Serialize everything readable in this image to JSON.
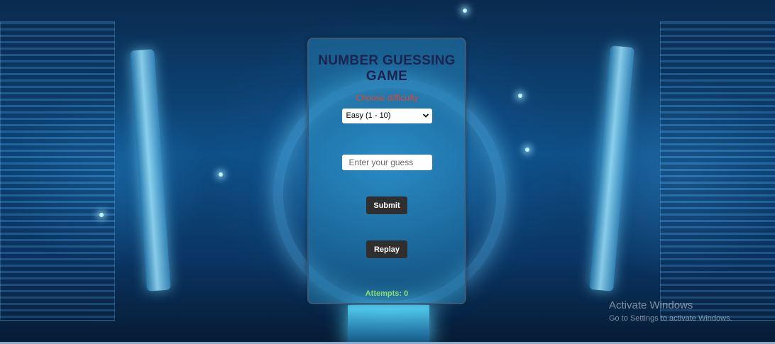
{
  "game": {
    "title": "NUMBER GUESSING GAME",
    "difficulty_label": "Choose difficulty",
    "difficulty_selected": "Easy (1 - 10)",
    "guess_placeholder": "Enter your guess",
    "submit_label": "Submit",
    "replay_label": "Replay",
    "attempts_text": "Attempts: 0"
  },
  "watermark": {
    "title": "Activate Windows",
    "subtitle": "Go to Settings to activate Windows."
  },
  "colors": {
    "title": "#1b2350",
    "difficulty_label": "#e0472e",
    "attempts": "#8fe06a",
    "button_bg": "#2f2f2f"
  },
  "icons": {
    "select_arrow": "chevron-down-icon"
  }
}
